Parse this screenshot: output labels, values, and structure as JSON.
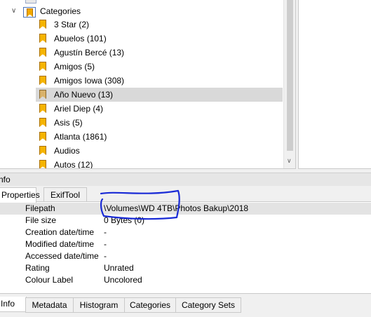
{
  "tree": {
    "root_label": "Categories",
    "selected_index": 5,
    "items": [
      {
        "label": "3 Star (2)"
      },
      {
        "label": "Abuelos (101)"
      },
      {
        "label": "Agustín Bercé (13)"
      },
      {
        "label": "Amigos (5)"
      },
      {
        "label": "Amigos Iowa (308)"
      },
      {
        "label": "Año Nuevo (13)"
      },
      {
        "label": "Ariel Diep (4)"
      },
      {
        "label": "Asis (5)"
      },
      {
        "label": "Atlanta (1861)"
      },
      {
        "label": "Audios"
      },
      {
        "label": "Autos (12)"
      }
    ]
  },
  "info_panel": {
    "title": "nfo",
    "tabs": [
      {
        "label": "Properties",
        "active": true
      },
      {
        "label": "ExifTool",
        "active": false
      }
    ],
    "properties": [
      {
        "key": "Filepath",
        "value": "\\Volumes\\WD 4TB\\Photos Bakup\\2018"
      },
      {
        "key": "File size",
        "value": "0 Bytes (0)"
      },
      {
        "key": "Creation date/time",
        "value": "-"
      },
      {
        "key": "Modified date/time",
        "value": "-"
      },
      {
        "key": "Accessed date/time",
        "value": "-"
      },
      {
        "key": "Rating",
        "value": "Unrated"
      },
      {
        "key": "Colour Label",
        "value": "Uncolored"
      }
    ]
  },
  "bottom_tabs": [
    {
      "label": "Info",
      "active": true
    },
    {
      "label": "Metadata",
      "active": false
    },
    {
      "label": "Histogram",
      "active": false
    },
    {
      "label": "Categories",
      "active": false
    },
    {
      "label": "Category Sets",
      "active": false
    }
  ],
  "colors": {
    "bookmark": "#f5b400",
    "selection": "#d9d9d9",
    "annotation": "#1a2bd6"
  }
}
